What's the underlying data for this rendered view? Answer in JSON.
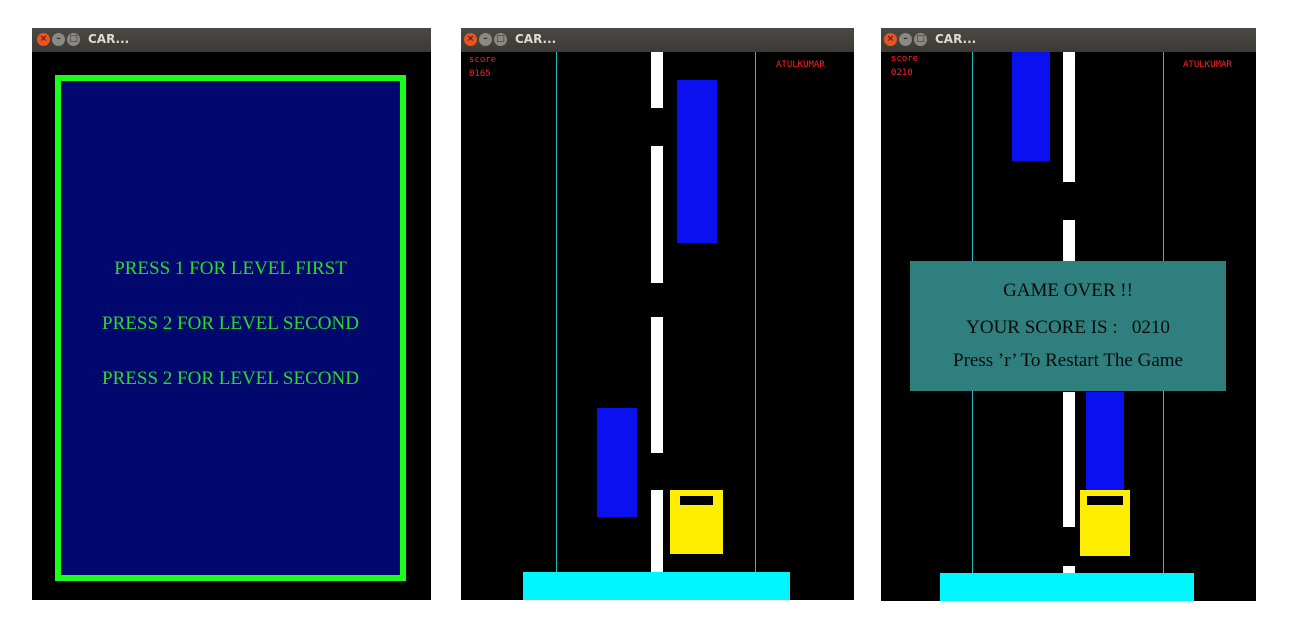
{
  "colors": {
    "menu_bg": "#00086e",
    "menu_border": "#1aff1a",
    "menu_text": "#2bd92b",
    "road_bg": "#000000",
    "lane_edge": "#1fbfbf",
    "lane_dash": "#ffffff",
    "enemy_car": "#0a10f0",
    "player_car": "#ffee00",
    "base_bar": "#00f7ff",
    "hud_text": "#ff2020",
    "gameover_panel": "#2e7f7d"
  },
  "windows": [
    {
      "title": "CAR...",
      "menu": {
        "lines": [
          "PRESS 1 FOR LEVEL FIRST",
          "PRESS 2 FOR LEVEL SECOND",
          "PRESS 2 FOR LEVEL SECOND"
        ]
      }
    },
    {
      "title": "CAR...",
      "hud": {
        "score_label": "score",
        "score_value": "0165",
        "player_name": "ATULKUMAR"
      }
    },
    {
      "title": "CAR...",
      "hud": {
        "score_label": "score",
        "score_value": "0210",
        "player_name": "ATULKUMAR"
      },
      "game_over": {
        "title": "GAME OVER !!",
        "score_line": "YOUR SCORE IS :   0210",
        "restart_hint": "Press ’r’ To Restart The Game"
      }
    }
  ]
}
